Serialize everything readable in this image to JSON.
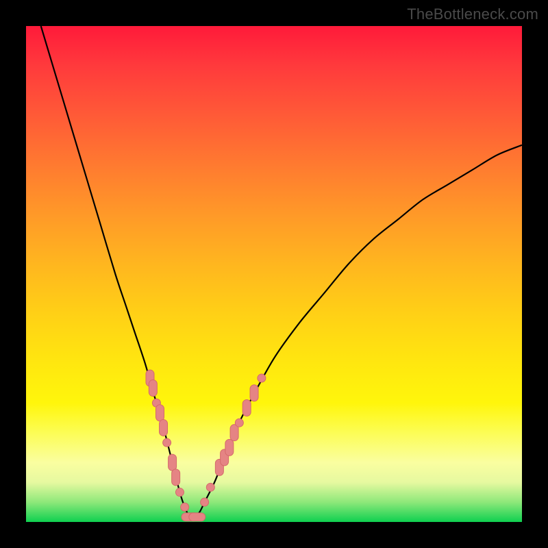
{
  "attribution": "TheBottleneck.com",
  "colors": {
    "frame": "#000000",
    "curve": "#000000",
    "marker_fill": "#e58484",
    "marker_stroke": "#d46a6a",
    "gradient_top": "#ff1a3a",
    "gradient_bottom": "#0fd050"
  },
  "chart_data": {
    "type": "line",
    "title": "",
    "xlabel": "",
    "ylabel": "",
    "xlim": [
      0,
      100
    ],
    "ylim": [
      0,
      100
    ],
    "series": [
      {
        "name": "curve",
        "x": [
          3,
          6,
          9,
          12,
          15,
          18,
          20,
          22,
          24,
          26,
          27,
          28,
          29,
          30,
          31,
          32,
          33,
          34,
          35,
          36,
          38,
          40,
          42,
          45,
          50,
          55,
          60,
          65,
          70,
          75,
          80,
          85,
          90,
          95,
          100
        ],
        "y": [
          100,
          90,
          80,
          70,
          60,
          50,
          44,
          38,
          32,
          25,
          22,
          18,
          14,
          10,
          6,
          3,
          1,
          1,
          2,
          4,
          8,
          13,
          18,
          24,
          33,
          40,
          46,
          52,
          57,
          61,
          65,
          68,
          71,
          74,
          76
        ]
      }
    ],
    "markers": [
      {
        "x": 25.0,
        "y": 29,
        "shape": "vbar"
      },
      {
        "x": 25.6,
        "y": 27,
        "shape": "vbar"
      },
      {
        "x": 26.3,
        "y": 24,
        "shape": "dot"
      },
      {
        "x": 27.0,
        "y": 22,
        "shape": "vbar"
      },
      {
        "x": 27.7,
        "y": 19,
        "shape": "vbar"
      },
      {
        "x": 28.4,
        "y": 16,
        "shape": "dot"
      },
      {
        "x": 29.5,
        "y": 12,
        "shape": "vbar"
      },
      {
        "x": 30.2,
        "y": 9,
        "shape": "vbar"
      },
      {
        "x": 31.0,
        "y": 6,
        "shape": "dot"
      },
      {
        "x": 32.0,
        "y": 3,
        "shape": "dot"
      },
      {
        "x": 33.0,
        "y": 1,
        "shape": "hbar"
      },
      {
        "x": 34.5,
        "y": 1,
        "shape": "hbar"
      },
      {
        "x": 36.0,
        "y": 4,
        "shape": "dot"
      },
      {
        "x": 37.2,
        "y": 7,
        "shape": "dot"
      },
      {
        "x": 39.0,
        "y": 11,
        "shape": "vbar"
      },
      {
        "x": 40.0,
        "y": 13,
        "shape": "vbar"
      },
      {
        "x": 41.0,
        "y": 15,
        "shape": "vbar"
      },
      {
        "x": 42.0,
        "y": 18,
        "shape": "vbar"
      },
      {
        "x": 43.0,
        "y": 20,
        "shape": "dot"
      },
      {
        "x": 44.5,
        "y": 23,
        "shape": "vbar"
      },
      {
        "x": 46.0,
        "y": 26,
        "shape": "vbar"
      },
      {
        "x": 47.5,
        "y": 29,
        "shape": "dot"
      }
    ],
    "annotations": []
  }
}
